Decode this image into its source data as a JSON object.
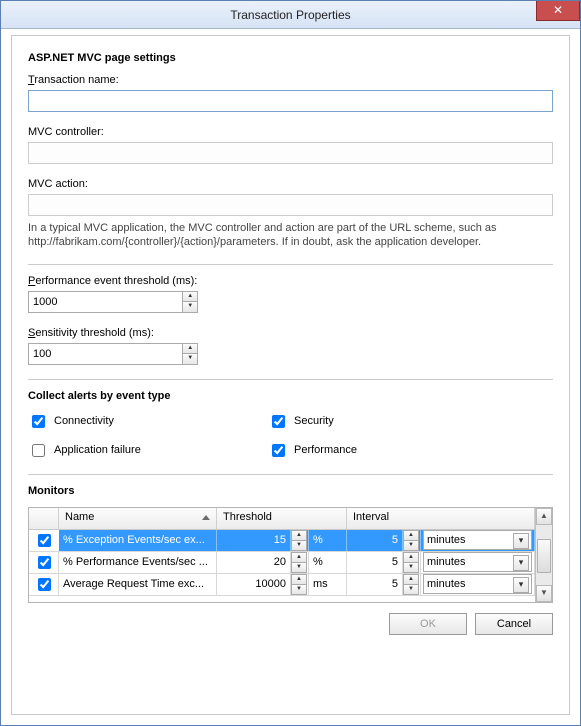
{
  "title": "Transaction Properties",
  "section1_heading": "ASP.NET MVC page settings",
  "transaction_name_label": "Transaction name:",
  "transaction_name_value": "",
  "mvc_controller_label": "MVC controller:",
  "mvc_controller_value": "",
  "mvc_action_label": "MVC action:",
  "mvc_action_value": "",
  "help_text": "In a typical MVC application, the MVC controller and action are part of the URL scheme, such as http://fabrikam.com/{controller}/{action}/parameters. If in doubt, ask the application developer.",
  "perf_threshold_label": "Performance event threshold (ms):",
  "perf_threshold_value": "1000",
  "sensitivity_label": "Sensitivity threshold (ms):",
  "sensitivity_value": "100",
  "section2_heading": "Collect alerts by event type",
  "checks": {
    "connectivity": {
      "label": "Connectivity",
      "checked": true
    },
    "security": {
      "label": "Security",
      "checked": true
    },
    "app_failure": {
      "label": "Application failure",
      "checked": false
    },
    "performance": {
      "label": "Performance",
      "checked": true
    }
  },
  "section3_heading": "Monitors",
  "monitors_cols": {
    "name": "Name",
    "threshold": "Threshold",
    "interval": "Interval"
  },
  "monitors_rows": [
    {
      "checked": true,
      "selected": true,
      "name": "% Exception Events/sec ex...",
      "threshold": "15",
      "unit": "%",
      "interval": "5",
      "interval_unit": "minutes"
    },
    {
      "checked": true,
      "selected": false,
      "name": "% Performance Events/sec ...",
      "threshold": "20",
      "unit": "%",
      "interval": "5",
      "interval_unit": "minutes"
    },
    {
      "checked": true,
      "selected": false,
      "name": "Average Request Time exc...",
      "threshold": "10000",
      "unit": "ms",
      "interval": "5",
      "interval_unit": "minutes"
    }
  ],
  "buttons": {
    "ok": "OK",
    "cancel": "Cancel"
  }
}
